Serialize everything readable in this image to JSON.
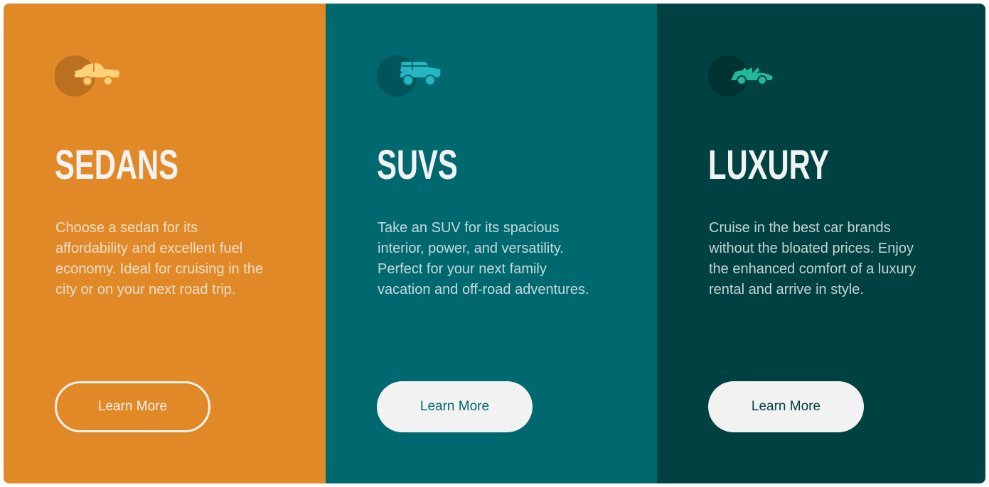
{
  "cards": [
    {
      "title": "SEDANS",
      "text": "Choose a sedan for its affordability and excellent fuel economy. Ideal for cruising in the city or on your next road trip.",
      "button": "Learn More",
      "icon": "sedan-icon",
      "accent": "#e28927",
      "icon_color": "#ffd27a"
    },
    {
      "title": "SUVS",
      "text": "Take an SUV for its spacious interior, power, and versatility. Perfect for your next family vacation and off-road adventures.",
      "button": "Learn More",
      "icon": "suv-icon",
      "accent": "#006970",
      "icon_color": "#25b6c2"
    },
    {
      "title": "LUXURY",
      "text": "Cruise in the best car brands without the bloated prices. Enjoy the enhanced comfort of a luxury rental and arrive in style.",
      "button": "Learn More",
      "icon": "convertible-icon",
      "accent": "#004241",
      "icon_color": "#24b89a"
    }
  ]
}
